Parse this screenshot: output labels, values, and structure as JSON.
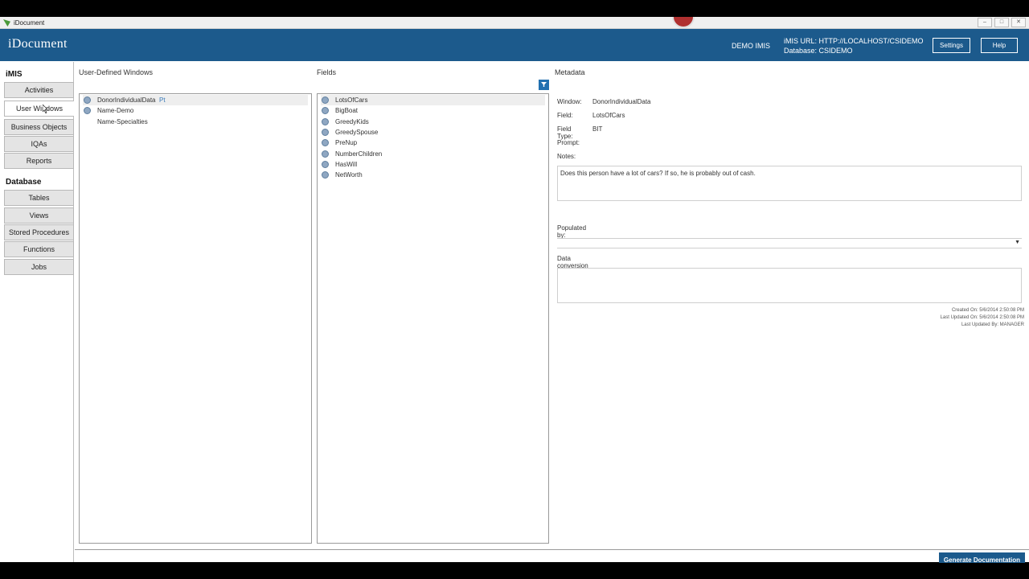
{
  "window": {
    "title": "iDocument"
  },
  "header": {
    "brand": "iDocument",
    "instance": "DEMO IMIS",
    "imis_url": "iMIS URL: HTTP://LOCALHOST/CSIDEMO",
    "database": "Database: CSIDEMO",
    "settings_label": "Settings",
    "help_label": "Help",
    "color": "#1c5a8c"
  },
  "sidebar": {
    "imis_title": "iMIS",
    "imis_items": [
      {
        "label": "Activities"
      },
      {
        "label": "User Windows",
        "active": true
      },
      {
        "label": "Business Objects"
      },
      {
        "label": "IQAs"
      },
      {
        "label": "Reports"
      }
    ],
    "database_title": "Database",
    "database_items": [
      {
        "label": "Tables"
      },
      {
        "label": "Views"
      },
      {
        "label": "Stored Procedures"
      },
      {
        "label": "Functions"
      },
      {
        "label": "Jobs"
      }
    ]
  },
  "windows_pane": {
    "title": "User-Defined Windows",
    "items": [
      {
        "label": "DonorIndividualData",
        "icon": "info-icon",
        "selected": true,
        "badge": "Pt"
      },
      {
        "label": "Name-Demo",
        "icon": "info-icon"
      },
      {
        "label": "Name-Specialties"
      }
    ]
  },
  "fields_pane": {
    "title": "Fields",
    "filter_icon": "filter-icon",
    "items": [
      {
        "label": "LotsOfCars",
        "selected": true
      },
      {
        "label": "BigBoat"
      },
      {
        "label": "GreedyKids"
      },
      {
        "label": "GreedySpouse"
      },
      {
        "label": "PreNup"
      },
      {
        "label": "NumberChildren"
      },
      {
        "label": "HasWill"
      },
      {
        "label": "NetWorth"
      }
    ]
  },
  "metadata": {
    "title": "Metadata",
    "window_label": "Window:",
    "window_value": "DonorIndividualData",
    "field_label": "Field:",
    "field_value": "LotsOfCars",
    "field_type_label": "Field Type:",
    "field_type_value": "BIT",
    "prompt_label": "Prompt:",
    "prompt_value": "",
    "notes_label": "Notes:",
    "notes_value": "Does this person have a lot of cars?  If so, he is probably out of cash.",
    "populated_by_label": "Populated by:",
    "populated_by_value": "",
    "conversion_label": "Data conversion notes:",
    "conversion_value": "",
    "created_on": "Created On: 5/6/2014 2:50:08 PM",
    "last_updated_on": "Last Updated On: 5/6/2014 2:50:08 PM",
    "last_updated_by": "Last Updated By: MANAGER"
  },
  "footer": {
    "generate_label": "Generate Documentation"
  }
}
